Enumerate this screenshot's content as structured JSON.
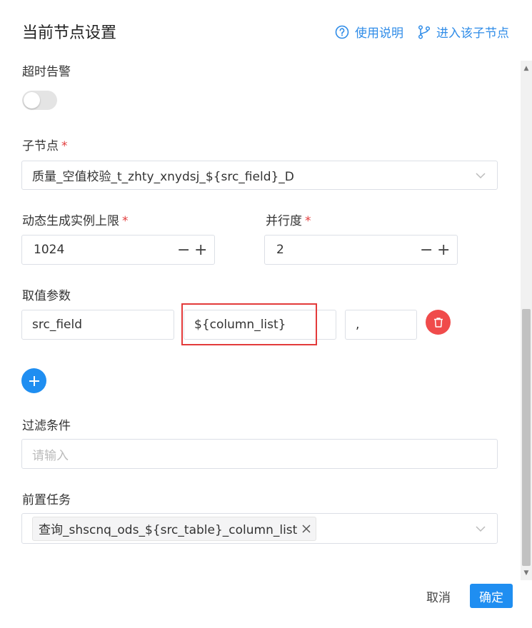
{
  "header": {
    "title": "当前节点设置",
    "help_link": "使用说明",
    "enter_child_link": "进入该子节点"
  },
  "timeout_alert": {
    "label": "超时告警",
    "enabled": false
  },
  "child_node": {
    "label": "子节点",
    "required_mark": "*",
    "value": "质量_空值校验_t_zhty_xnydsj_${src_field}_D"
  },
  "dynamic_limit": {
    "label": "动态生成实例上限",
    "required_mark": "*",
    "value": "1024",
    "minus": "−",
    "plus": "+"
  },
  "parallelism": {
    "label": "并行度",
    "required_mark": "*",
    "value": "2",
    "minus": "−",
    "plus": "+"
  },
  "params": {
    "label": "取值参数",
    "rows": [
      {
        "name": "src_field",
        "value": "${column_list}",
        "separator": ","
      }
    ]
  },
  "filter": {
    "label": "过滤条件",
    "placeholder": "请输入"
  },
  "pre_task": {
    "label": "前置任务",
    "tags": [
      "查询_shscnq_ods_${src_table}_column_list"
    ]
  },
  "footer": {
    "cancel": "取消",
    "confirm": "确定"
  },
  "colors": {
    "primary": "#1f8ef1",
    "danger": "#f04b4b",
    "required": "#e23c3c",
    "highlight": "#e33a3a"
  }
}
